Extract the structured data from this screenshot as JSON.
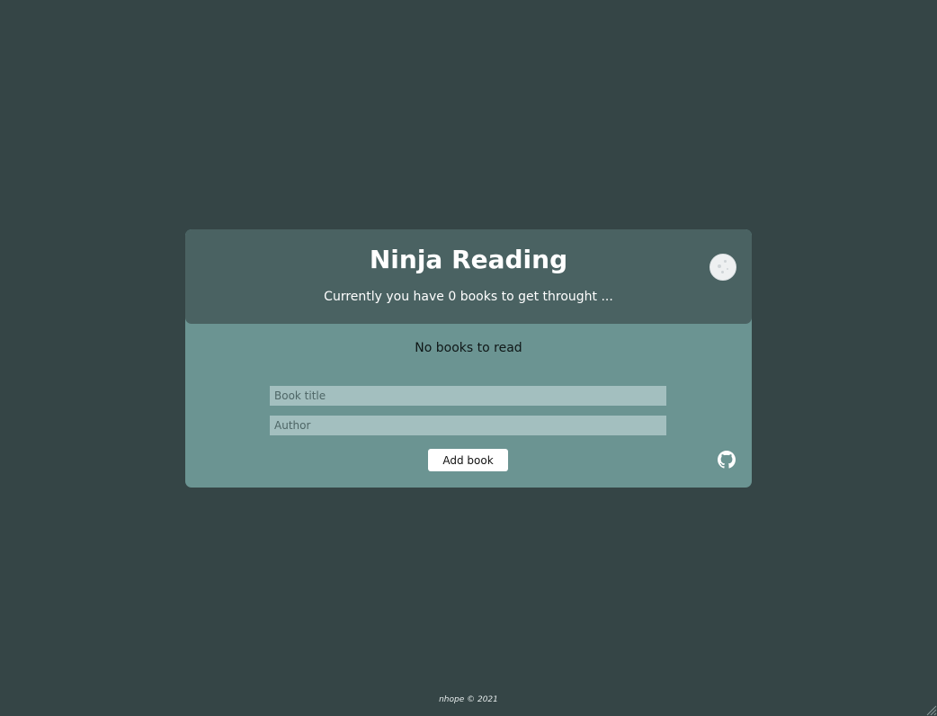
{
  "header": {
    "title": "Ninja Reading",
    "subtitle": "Currently you have 0 books to get throught ..."
  },
  "theme_toggle": {
    "icon": "moon-icon",
    "color": "#eef0f1"
  },
  "list": {
    "empty_message": "No books to read"
  },
  "form": {
    "title_placeholder": "Book title",
    "title_value": "",
    "author_placeholder": "Author",
    "author_value": "",
    "submit_label": "Add book"
  },
  "links": {
    "github_icon": "github-icon"
  },
  "footer": {
    "text": "nhope © 2021"
  },
  "colors": {
    "page_background": "#354546",
    "header_background": "#4a6262",
    "card_background": "#6b9492",
    "input_background": "#a3bfbf",
    "button_background": "#ffffff"
  }
}
